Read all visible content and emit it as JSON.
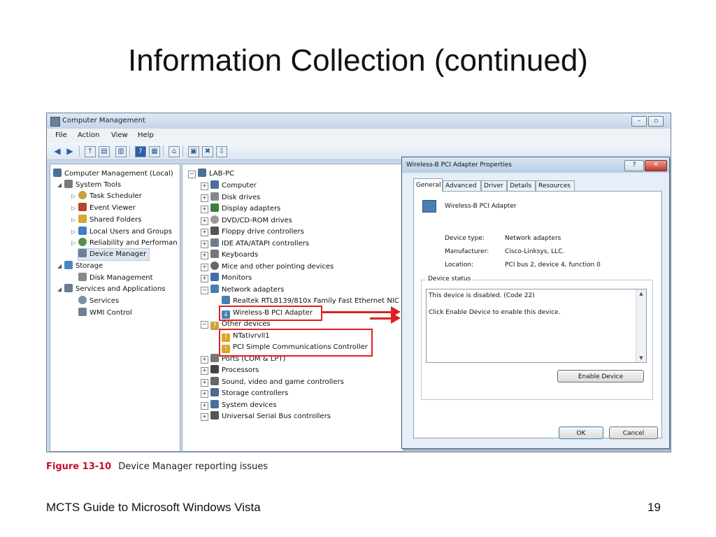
{
  "slide": {
    "title": "Information Collection (continued)",
    "footer_left": "MCTS Guide to Microsoft Windows Vista",
    "page_number": "19",
    "caption_label": "Figure 13-10",
    "caption_text": "Device Manager reporting issues"
  },
  "window": {
    "title": "Computer Management",
    "minimize": "–",
    "restore": "▫",
    "menu": [
      "File",
      "Action",
      "View",
      "Help"
    ]
  },
  "left_tree": [
    {
      "label": "Computer Management (Local)",
      "icon": "computer-icon",
      "color": "#4a6f9c"
    },
    {
      "label": "System Tools",
      "icon": "tools-icon",
      "color": "#7a7a7a"
    },
    {
      "label": "Task Scheduler",
      "icon": "clock-icon",
      "color": "#c8a13a"
    },
    {
      "label": "Event Viewer",
      "icon": "event-icon",
      "color": "#b5452f"
    },
    {
      "label": "Shared Folders",
      "icon": "folder-icon",
      "color": "#d6a63b"
    },
    {
      "label": "Local Users and Groups",
      "icon": "users-icon",
      "color": "#3f7fc4"
    },
    {
      "label": "Reliability and Performan",
      "icon": "performance-icon",
      "color": "#5b8f4a"
    },
    {
      "label": "Device Manager",
      "icon": "device-manager-icon",
      "color": "#6c7f95"
    },
    {
      "label": "Storage",
      "icon": "storage-icon",
      "color": "#4f86c6"
    },
    {
      "label": "Disk Management",
      "icon": "disk-icon",
      "color": "#888888"
    },
    {
      "label": "Services and Applications",
      "icon": "services-icon",
      "color": "#6a7a8f"
    },
    {
      "label": "Services",
      "icon": "gear-icon",
      "color": "#7b8ea5"
    },
    {
      "label": "WMI Control",
      "icon": "wmi-icon",
      "color": "#6f7f90"
    }
  ],
  "device_tree": [
    {
      "label": "LAB-PC",
      "icon": "computer-icon",
      "color": "#4a6f9c"
    },
    {
      "label": "Computer",
      "icon": "computer-icon",
      "color": "#4a6f9c"
    },
    {
      "label": "Disk drives",
      "icon": "disk-icon",
      "color": "#888888"
    },
    {
      "label": "Display adapters",
      "icon": "display-icon",
      "color": "#3e7d3a"
    },
    {
      "label": "DVD/CD-ROM drives",
      "icon": "dvd-icon",
      "color": "#9a9a9a"
    },
    {
      "label": "Floppy drive controllers",
      "icon": "floppy-icon",
      "color": "#555555"
    },
    {
      "label": "IDE ATA/ATAPI controllers",
      "icon": "ide-icon",
      "color": "#6e7e8e"
    },
    {
      "label": "Keyboards",
      "icon": "keyboard-icon",
      "color": "#777777"
    },
    {
      "label": "Mice and other pointing devices",
      "icon": "mouse-icon",
      "color": "#666666"
    },
    {
      "label": "Monitors",
      "icon": "monitor-icon",
      "color": "#3f6fa7"
    },
    {
      "label": "Network adapters",
      "icon": "network-icon",
      "color": "#4a7fb0"
    },
    {
      "label": "Realtek RTL8139/810x Family Fast Ethernet NIC",
      "icon": "network-icon",
      "color": "#4a7fb0"
    },
    {
      "label": "Wireless-B PCI Adapter",
      "icon": "disabled-network-icon",
      "color": "#4a7fb0"
    },
    {
      "label": "Other devices",
      "icon": "unknown-device-icon",
      "color": "#c9a33a"
    },
    {
      "label": "NTativrvll1",
      "icon": "warning-icon",
      "color": "#d9a52b"
    },
    {
      "label": "PCI Simple Communications Controller",
      "icon": "warning-icon",
      "color": "#d9a52b"
    },
    {
      "label": "Ports (COM & LPT)",
      "icon": "port-icon",
      "color": "#777777"
    },
    {
      "label": "Processors",
      "icon": "processor-icon",
      "color": "#444444"
    },
    {
      "label": "Sound, video and game controllers",
      "icon": "speaker-icon",
      "color": "#666666"
    },
    {
      "label": "Storage controllers",
      "icon": "storage-controller-icon",
      "color": "#4b6b8f"
    },
    {
      "label": "System devices",
      "icon": "system-icon",
      "color": "#4a6f9c"
    },
    {
      "label": "Universal Serial Bus controllers",
      "icon": "usb-icon",
      "color": "#555555"
    }
  ],
  "dialog": {
    "title": "Wireless-B PCI Adapter Properties",
    "help": "?",
    "close": "✕",
    "tabs": [
      "General",
      "Advanced",
      "Driver",
      "Details",
      "Resources"
    ],
    "device_name": "Wireless-B PCI Adapter",
    "fields": [
      {
        "label": "Device type:",
        "value": "Network adapters"
      },
      {
        "label": "Manufacturer:",
        "value": "Cisco-Linksys, LLC."
      },
      {
        "label": "Location:",
        "value": "PCI bus 2, device 4, function 0"
      }
    ],
    "status_legend": "Device status",
    "status_line1": "This device is disabled. (Code 22)",
    "status_line2": "Click Enable Device to enable this device.",
    "enable_button": "Enable Device",
    "ok_button": "OK",
    "cancel_button": "Cancel"
  },
  "colors": {
    "highlight": "#e02020",
    "caption_label": "#c8102e"
  }
}
